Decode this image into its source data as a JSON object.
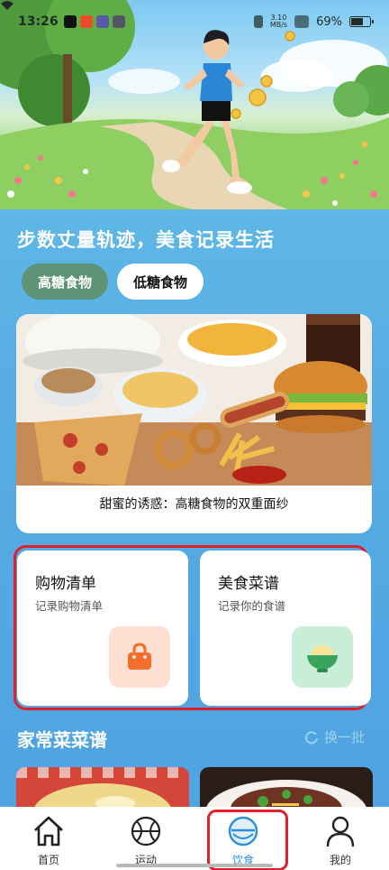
{
  "status_bar": {
    "time": "13:26",
    "net_speed_value": "3.10",
    "net_speed_unit": "MB/s",
    "battery_label": "69%",
    "battery_level": 0.69
  },
  "headline": "步数丈量轨迹，美食记录生活",
  "tabs": [
    {
      "label": "高糖食物",
      "active": true
    },
    {
      "label": "低糖食物",
      "active": false
    }
  ],
  "food_card": {
    "caption": "甜蜜的诱惑：高糖食物的双重面纱"
  },
  "features": [
    {
      "title": "购物清单",
      "subtitle": "记录购物清单",
      "icon": "shopping-bag-icon",
      "icon_bg": "#fde0d2",
      "icon_color": "#f26d2e"
    },
    {
      "title": "美食菜谱",
      "subtitle": "记录你的食谱",
      "icon": "rice-bowl-icon",
      "icon_bg": "#c9eed8",
      "icon_color": "#3aa35e"
    }
  ],
  "recipes_section": {
    "title": "家常菜菜谱",
    "refresh_label": "换一批"
  },
  "bottom_nav": [
    {
      "label": "首页",
      "icon": "home-icon",
      "active": false
    },
    {
      "label": "运动",
      "icon": "ball-icon",
      "active": false
    },
    {
      "label": "饮食",
      "icon": "bowl-icon",
      "active": true
    },
    {
      "label": "我的",
      "icon": "person-icon",
      "active": false
    }
  ],
  "colors": {
    "accent": "#2f8fdc",
    "tab_active": "#5f9376",
    "highlight": "#e0202a"
  }
}
